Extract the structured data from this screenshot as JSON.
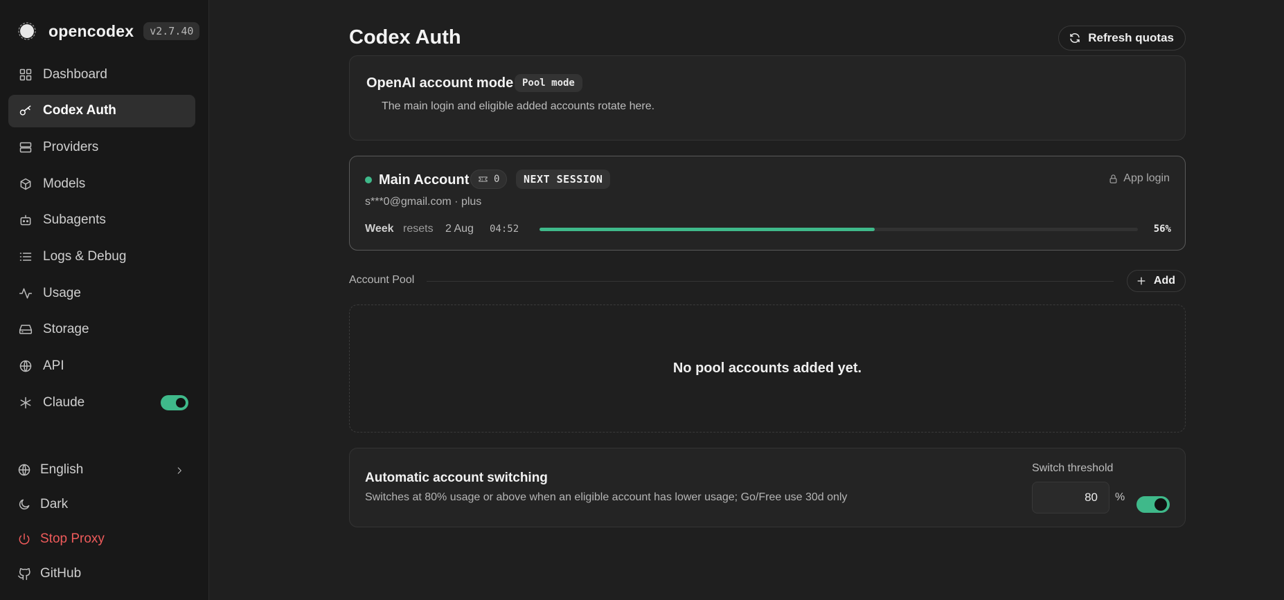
{
  "app": {
    "name": "opencodex",
    "version": "v2.7.40"
  },
  "sidebar": {
    "items": [
      {
        "label": "Dashboard",
        "icon": "dashboard-icon"
      },
      {
        "label": "Codex Auth",
        "icon": "key-icon",
        "active": true
      },
      {
        "label": "Providers",
        "icon": "server-icon"
      },
      {
        "label": "Models",
        "icon": "cube-icon"
      },
      {
        "label": "Subagents",
        "icon": "bot-icon"
      },
      {
        "label": "Logs & Debug",
        "icon": "list-icon"
      },
      {
        "label": "Usage",
        "icon": "activity-icon"
      },
      {
        "label": "Storage",
        "icon": "hard-drive-icon"
      },
      {
        "label": "API",
        "icon": "globe-icon"
      },
      {
        "label": "Claude",
        "icon": "asterisk-icon",
        "toggle_on": true
      }
    ],
    "bottom": [
      {
        "label": "English",
        "icon": "globe-icon"
      },
      {
        "label": "Dark",
        "icon": "moon-icon"
      },
      {
        "label": "Stop Proxy",
        "icon": "power-icon"
      },
      {
        "label": "GitHub",
        "icon": "github-icon"
      }
    ]
  },
  "header": {
    "title": "Codex Auth",
    "refresh_label": "Refresh quotas"
  },
  "mode": {
    "title": "OpenAI account mode",
    "badge": "Pool mode",
    "description": "The main login and eligible added accounts rotate here."
  },
  "main_account": {
    "name": "Main Account",
    "ticket_count": "0",
    "badge": "NEXT SESSION",
    "login_type": "App login",
    "email_line": "s***0@gmail.com · plus",
    "status_color": "#3fb98a",
    "quota": {
      "label": "Week",
      "resets_label": "resets",
      "reset_date": "2 Aug",
      "reset_time": "04:52",
      "percent_text": "56%",
      "percent": 56
    }
  },
  "pool": {
    "title": "Account Pool",
    "add_label": "Add",
    "empty_text": "No pool accounts added yet."
  },
  "switching": {
    "title": "Automatic account switching",
    "description": "Switches at 80% usage or above when an eligible account has lower usage; Go/Free use 30d only",
    "threshold_label": "Switch threshold",
    "threshold_value": "80",
    "unit": "%",
    "enabled": true
  },
  "colors": {
    "accent": "#3fb98a",
    "danger": "#ef5b5b",
    "background": "#1f1f1f",
    "sidebar": "#181818"
  }
}
